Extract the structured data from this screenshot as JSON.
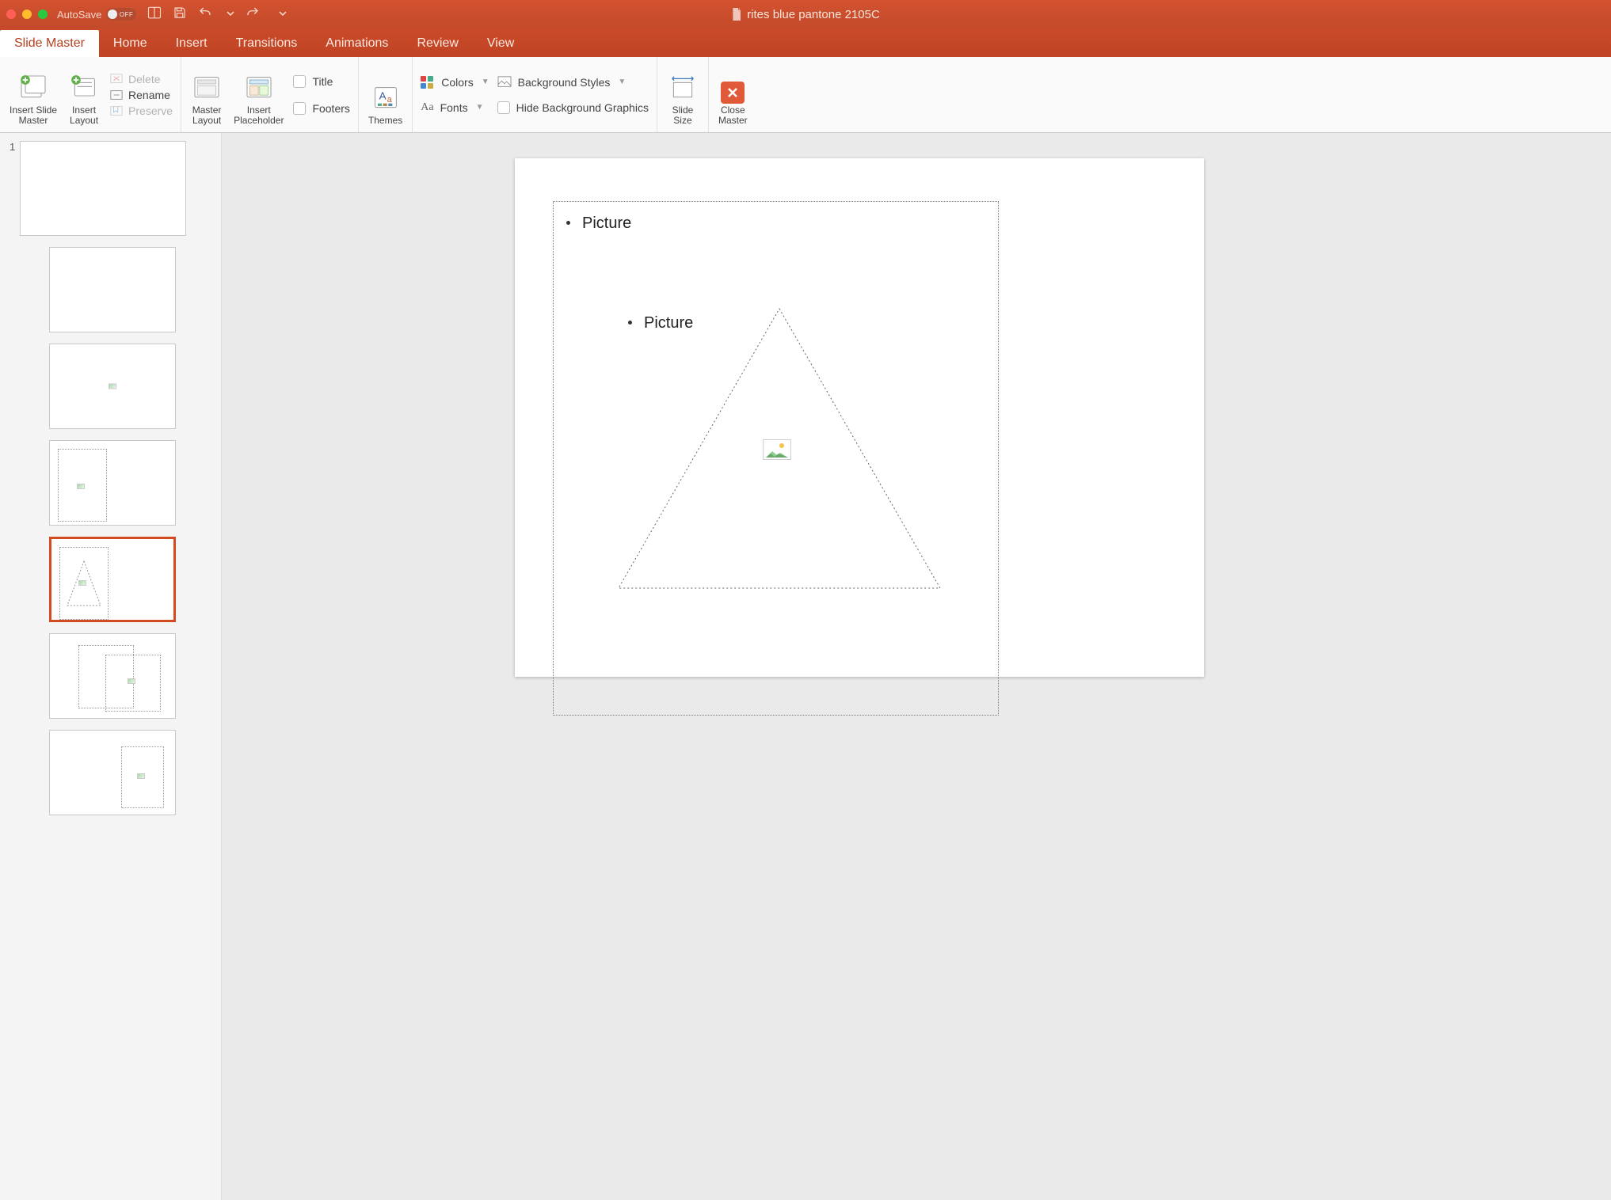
{
  "titlebar": {
    "autosave_label": "AutoSave",
    "autosave_state": "OFF",
    "document_title": "rites blue pantone 2105C"
  },
  "tabs": {
    "items": [
      {
        "label": "Slide Master",
        "active": true
      },
      {
        "label": "Home",
        "active": false
      },
      {
        "label": "Insert",
        "active": false
      },
      {
        "label": "Transitions",
        "active": false
      },
      {
        "label": "Animations",
        "active": false
      },
      {
        "label": "Review",
        "active": false
      },
      {
        "label": "View",
        "active": false
      }
    ]
  },
  "ribbon": {
    "insert_slide_master": "Insert Slide\nMaster",
    "insert_layout": "Insert\nLayout",
    "delete": "Delete",
    "rename": "Rename",
    "preserve": "Preserve",
    "master_layout": "Master\nLayout",
    "insert_placeholder": "Insert\nPlaceholder",
    "title": "Title",
    "footers": "Footers",
    "themes": "Themes",
    "colors": "Colors",
    "fonts": "Fonts",
    "background_styles": "Background Styles",
    "hide_bg_graphics": "Hide Background Graphics",
    "slide_size": "Slide\nSize",
    "close_master": "Close\nMaster"
  },
  "sidebar": {
    "master_number": "1",
    "selected_index": 4
  },
  "canvas": {
    "outer_label": "Picture",
    "inner_label": "Picture"
  }
}
